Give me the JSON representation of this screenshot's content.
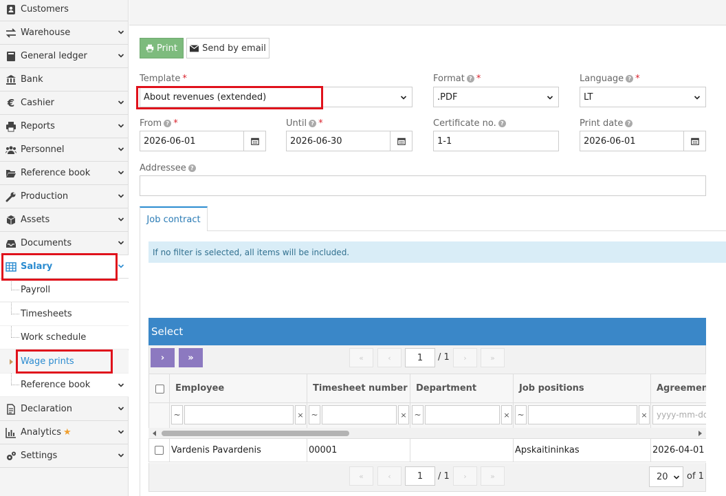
{
  "sidebar": {
    "items": [
      {
        "label": "Customers",
        "icon": "customers-icon"
      },
      {
        "label": "Warehouse",
        "icon": "warehouse-icon"
      },
      {
        "label": "General ledger",
        "icon": "ledger-icon"
      },
      {
        "label": "Bank",
        "icon": "bank-icon"
      },
      {
        "label": "Cashier",
        "icon": "euro-icon"
      },
      {
        "label": "Reports",
        "icon": "print-icon"
      },
      {
        "label": "Personnel",
        "icon": "users-icon"
      },
      {
        "label": "Reference book",
        "icon": "folder-icon"
      },
      {
        "label": "Production",
        "icon": "wrench-icon"
      },
      {
        "label": "Assets",
        "icon": "cube-icon"
      },
      {
        "label": "Documents",
        "icon": "inbox-icon"
      },
      {
        "label": "Salary",
        "icon": "table-icon"
      },
      {
        "label": "Declaration",
        "icon": "document-icon"
      },
      {
        "label": "Analytics",
        "icon": "bar-chart-icon"
      },
      {
        "label": "Settings",
        "icon": "cogs-icon"
      }
    ],
    "salary_sub": [
      "Payroll",
      "Timesheets",
      "Work schedule",
      "Wage prints",
      "Reference book"
    ]
  },
  "toolbar": {
    "print": "Print",
    "email": "Send by email"
  },
  "form": {
    "template_label": "Template",
    "template_value": "About revenues (extended)",
    "format_label": "Format",
    "format_value": ".PDF",
    "language_label": "Language",
    "language_value": "LT",
    "from_label": "From",
    "from_value": "2026-06-01",
    "until_label": "Until",
    "until_value": "2026-06-30",
    "cert_label": "Certificate no.",
    "cert_value": "1-1",
    "print_date_label": "Print date",
    "print_date_value": "2026-06-01",
    "addressee_label": "Addressee",
    "required_mark": "*",
    "help_mark": "?"
  },
  "tabs": {
    "job_contract": "Job contract"
  },
  "info": "If no filter is selected, all items will be included.",
  "grid": {
    "title": "Select",
    "page": "1",
    "page_of": "/ 1",
    "page_size": "20",
    "of_total": "of 1",
    "columns": [
      "Employee",
      "Timesheet number",
      "Department",
      "Job positions",
      "Agreement"
    ],
    "filter": {
      "tilde": "~",
      "clear": "×",
      "date_placeholder": "yyyy-mm-dd"
    },
    "rows": [
      {
        "employee": "Vardenis Pavardenis",
        "timesheet": "00001",
        "department": "",
        "position": "Apskaitininkas",
        "agreement": "2026-04-01"
      }
    ]
  },
  "colors": {
    "accent": "#2a8bd0",
    "grid_header": "#3a87c8",
    "highlight": "#e0111b",
    "print_btn": "#7dbb7d",
    "pager_btn": "#8c79c0"
  }
}
